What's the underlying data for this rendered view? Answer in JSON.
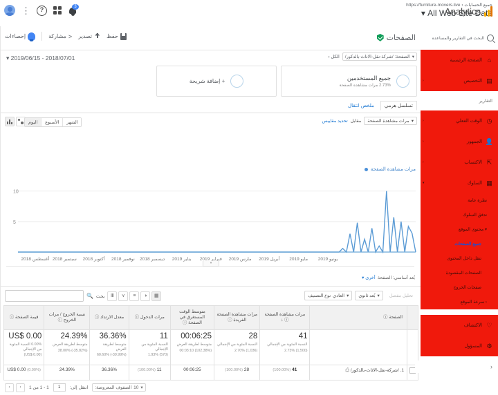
{
  "header": {
    "account_path": "جميع الحسابات ‹ https://furniture-movers.live",
    "property_view": "All Web Site Data ▾",
    "brand": "Analytics",
    "notification_count": "3",
    "icons": {
      "help": "?",
      "more": "⋮"
    }
  },
  "toolbar": {
    "page_title": "الصفحات",
    "save": "حفظ",
    "export": "تصدير",
    "share": "مشاركة",
    "edit": "تعديل",
    "insights": "إحصاءات"
  },
  "controls": {
    "date_range": "2019/06/15 - 2018/07/01",
    "date_caret": "▾",
    "page_filter_prefix": "الكل ‹",
    "page_filter_value": "الصفحة: /شركة-نقل-الاثاث-بالدكور/",
    "page_filter_caret": "▾"
  },
  "segments": [
    {
      "name": "جميع المستخدمين",
      "sub": "2.73% مرات مشاهدة الصفحة"
    }
  ],
  "add_segment": "+ إضافة شريحة",
  "tabs": [
    {
      "label": "تسلسل هرمي",
      "active": true
    },
    {
      "label": "ملخص انتقال",
      "active": false
    }
  ],
  "chart_controls": {
    "granularity": [
      {
        "label": "الشهر",
        "selected": false
      },
      {
        "label": "الأسبوع",
        "selected": false
      },
      {
        "label": "اليوم",
        "selected": true
      }
    ],
    "metric_primary": "مرات مشاهدة الصفحة",
    "metric_caret": "▾",
    "versus": "مقابل",
    "select_metric": "تحديد مقاييس",
    "legend": "مرات مشاهدة الصفحة",
    "resize_handle": "▾"
  },
  "chart_data": {
    "type": "line",
    "title": "مرات مشاهدة الصفحة",
    "xlabel": "",
    "ylabel": "",
    "ylim": [
      0,
      12
    ],
    "yticks": [
      "10",
      "5"
    ],
    "ytick_values": [
      10,
      5
    ],
    "grid": true,
    "legend_position": "top-right",
    "categories": [
      "أغسطس 2018",
      "سبتمبر 2018",
      "أكتوبر 2018",
      "نوفمبر 2018",
      "ديسمبر 2018",
      "يناير 2019",
      "فبراير 2019",
      "مارس 2019",
      "أبريل 2019",
      "مايو 2019",
      "يونيو 2019"
    ],
    "series": [
      {
        "name": "مرات مشاهدة الصفحة",
        "color": "#5b9bd5",
        "values": [
          0,
          0,
          0,
          0,
          0,
          0,
          0,
          0,
          0,
          0,
          0,
          0,
          0,
          0,
          0,
          0,
          0,
          0,
          0,
          0,
          0,
          0,
          0,
          0,
          0,
          0,
          0,
          0,
          0,
          0,
          0,
          0,
          0,
          0,
          0,
          0,
          0,
          0,
          0,
          0,
          0,
          0,
          0,
          0,
          0,
          0,
          0,
          0,
          0,
          0,
          0,
          0,
          0,
          0,
          0,
          0,
          0,
          0,
          0,
          0,
          0,
          0,
          0,
          0,
          0,
          0,
          0,
          0,
          0,
          0,
          0,
          0,
          0,
          0,
          0,
          0,
          0,
          0,
          0,
          0,
          0,
          0,
          0,
          0,
          0,
          0,
          0,
          0,
          0,
          0.6,
          0,
          3.0,
          0,
          4.8,
          0,
          2.1,
          0,
          3.9,
          0,
          1.0,
          0,
          10.0,
          0,
          5.7,
          0,
          5.0,
          0,
          4.2,
          3.1,
          0
        ]
      }
    ]
  },
  "table_meta": {
    "primary_dimension_label": "بُعد أساسي: الصفحة",
    "other": "أخرى ▾",
    "drilldown": "تحليل مفصل",
    "secondary_dimension": "بُعد ثانوي",
    "sort_type_label": "نوع التصنيف",
    "sort_type_value": "العادي",
    "caret": "▾",
    "search_label": "بحث",
    "search_value": "",
    "search_placeholder": "",
    "view_buttons": [
      "▦",
      "◑",
      "≡",
      "⋎",
      "Ⅲ"
    ]
  },
  "table": {
    "headers": [
      "الصفحة",
      "مرات مشاهدة الصفحة",
      "مرات مشاهدة الصفحة الفريدة",
      "متوسط الوقت المستغرق في الصفحة",
      "مرات الدخول",
      "معدل الارتداد",
      "نسبة الخروج / مرات الخروج",
      "قيمة الصفحة"
    ],
    "sort_indicator": "↓",
    "info_icon": "ⓘ",
    "summary": [
      {
        "value": "41",
        "sub1": "النسبة المئوية من الإجمالي",
        "sub2": "(1,500) 2.73%"
      },
      {
        "value": "28",
        "sub1": "النسبة المئوية من الإجمالي",
        "sub2": "(1,036) 2.70%"
      },
      {
        "value": "00:06:25",
        "sub1": "متوسط لطريقة العرض",
        "sub2": "(102.38%) 00:03:10"
      },
      {
        "value": "11",
        "sub1": "النسبة المئوية من الإجمالي",
        "sub2": "(570) 1.93%"
      },
      {
        "value": "36.36%",
        "sub1": "متوسط لطريقة العرض",
        "sub2": "(39.99%-) 60.60%"
      },
      {
        "value": "24.39%",
        "sub1": "متوسط لطريقة العرض",
        "sub2": "(35.82%-) 38.00%"
      },
      {
        "value": "US$ 0.00",
        "sub1": "0.00% النسبة المئوية من الإجمالي",
        "sub2": "(US$ 0.00)"
      }
    ],
    "rows": [
      {
        "index": "1.",
        "page": "/شركة-نقل-الاثاث-بالدكور/",
        "pageviews": "41",
        "pageviews_pct": "(100.00%)",
        "unique": "28",
        "unique_pct": "(100.00%)",
        "avg_time": "00:06:25",
        "avg_time_pct": "",
        "entrances": "11",
        "entrances_pct": "(100.00%)",
        "bounce": "36.36%",
        "bounce_pct": "",
        "exit": "24.39%",
        "exit_pct": "",
        "value": "US$ 0.00",
        "value_pct": "(0.00%)"
      }
    ]
  },
  "pager": {
    "rows_label": "الصفوف المعروضة:",
    "rows_value": "10",
    "caret": "▾",
    "goto_label": "انتقل إلى:",
    "goto_value": "1",
    "range": "1 - 1 من 1",
    "prev": "‹",
    "next": "›"
  },
  "sidebar": {
    "search_placeholder": "البحث في التقارير والمساعدة",
    "group1": [
      {
        "icon": "⌂",
        "label": "الصفحة الرئيسية",
        "arrow": ""
      },
      {
        "icon": "▤",
        "label": "التخصيص",
        "arrow": "‹"
      }
    ],
    "section_label": "التقارير",
    "group2": [
      {
        "icon": "◷",
        "label": "الوقت الفعلي",
        "arrow": "‹"
      },
      {
        "icon": "👤",
        "label": "الجمهور",
        "arrow": "‹"
      },
      {
        "icon": "⇱",
        "label": "الاكتساب",
        "arrow": "‹"
      },
      {
        "icon": "▦",
        "label": "السلوك",
        "arrow": "▾"
      }
    ],
    "behavior_sub": [
      {
        "label": "نظرة عامة",
        "level": 2,
        "selected": false
      },
      {
        "label": "تدفق السلوك",
        "level": 2,
        "selected": false
      },
      {
        "label": "▾ محتوى الموقع",
        "level": 2,
        "selected": false
      },
      {
        "label": "جميع الصفحات",
        "level": 3,
        "selected": true
      },
      {
        "label": "تنقل داخل المحتوى",
        "level": 3,
        "selected": false
      },
      {
        "label": "الصفحات المقصودة",
        "level": 3,
        "selected": false
      },
      {
        "label": "صفحات الخروج",
        "level": 3,
        "selected": false
      },
      {
        "label": "‹ سرعة الموقع",
        "level": 2,
        "selected": false
      }
    ],
    "group3": [
      {
        "icon": "♡",
        "label": "الاكتشاف",
        "arrow": ""
      },
      {
        "icon": "⚙",
        "label": "المسؤول",
        "arrow": ""
      }
    ],
    "collapse_icon": "‹"
  },
  "colors": {
    "sidebar_red": "#f0190c",
    "chart_line": "#5b9bd5",
    "link_blue": "#1976d2",
    "brand_orange": "#f9ab00"
  }
}
